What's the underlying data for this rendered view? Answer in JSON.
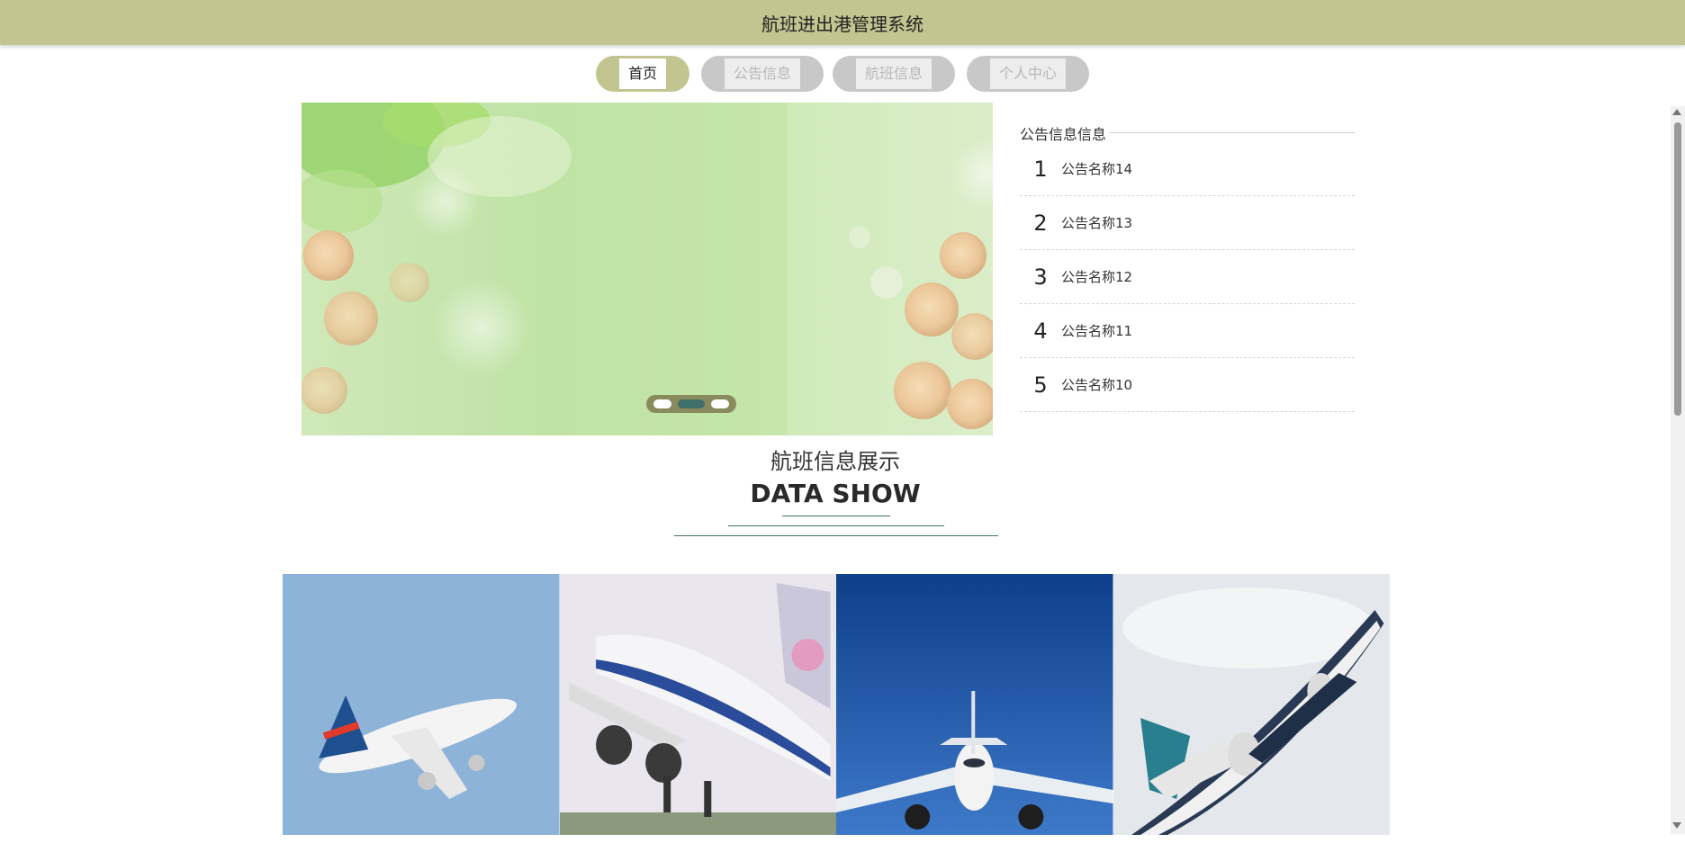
{
  "header": {
    "title": "航班进出港管理系统"
  },
  "nav": {
    "items": [
      {
        "label": "首页",
        "active": true
      },
      {
        "label": "公告信息",
        "active": false
      },
      {
        "label": "航班信息",
        "active": false
      },
      {
        "label": "个人中心",
        "active": false
      }
    ]
  },
  "carousel": {
    "slide_count": 3,
    "active_index": 1
  },
  "notice": {
    "title": "公告信息信息",
    "items": [
      {
        "num": "1",
        "text": "公告名称14"
      },
      {
        "num": "2",
        "text": "公告名称13"
      },
      {
        "num": "3",
        "text": "公告名称12"
      },
      {
        "num": "4",
        "text": "公告名称11"
      },
      {
        "num": "5",
        "text": "公告名称10"
      }
    ]
  },
  "section": {
    "title_cn": "航班信息展示",
    "title_en": "DATA SHOW"
  },
  "gallery": {
    "items": [
      {
        "icon": "airplane-icon"
      },
      {
        "icon": "airplane-icon"
      },
      {
        "icon": "airplane-icon"
      },
      {
        "icon": "airplane-icon"
      }
    ]
  },
  "colors": {
    "header_bg": "#c3c590",
    "accent": "#3f6f6b",
    "nav_inactive": "#c8c8c8"
  }
}
